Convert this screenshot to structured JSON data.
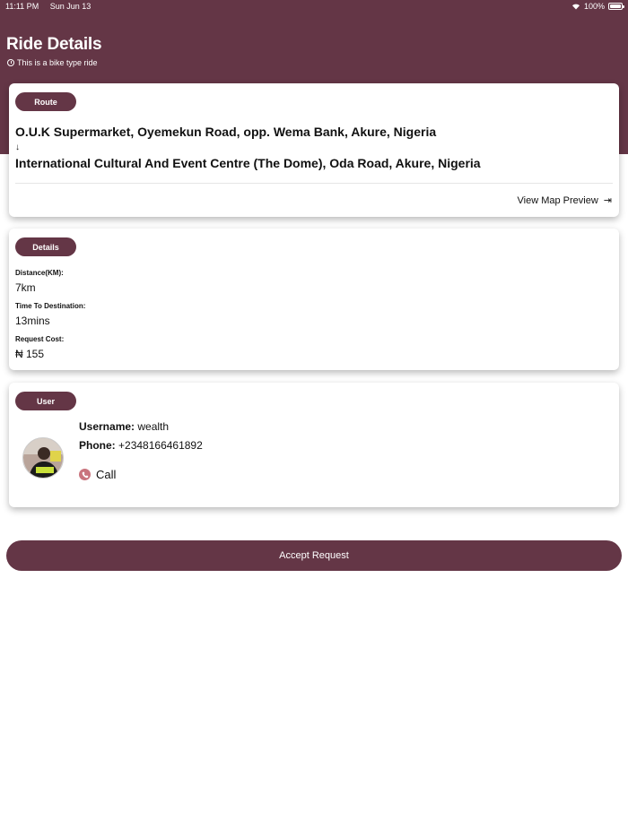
{
  "status_bar": {
    "time": "11:11 PM",
    "date": "Sun Jun 13",
    "battery": "100%"
  },
  "header": {
    "title": "Ride Details",
    "subtitle": "This is a bike type ride"
  },
  "route": {
    "pill": "Route",
    "from": "O.U.K Supermarket, Oyemekun Road, opp. Wema Bank, Akure, Nigeria",
    "arrow": "↓",
    "to": "International Cultural And Event Centre (The Dome), Oda Road, Akure, Nigeria",
    "map_link": "View Map Preview"
  },
  "details": {
    "pill": "Details",
    "distance_label": "Distance(KM):",
    "distance_value": "7km",
    "time_label": "Time To Destination:",
    "time_value": "13mins",
    "cost_label": "Request Cost:",
    "cost_value": "₦ 155"
  },
  "user": {
    "pill": "User",
    "username_label": "Username:",
    "username_value": "wealth",
    "phone_label": "Phone:",
    "phone_value": "+2348166461892",
    "call_label": "Call"
  },
  "actions": {
    "accept_label": "Accept Request"
  },
  "colors": {
    "brand": "#643646",
    "call_icon": "#c9747e"
  }
}
